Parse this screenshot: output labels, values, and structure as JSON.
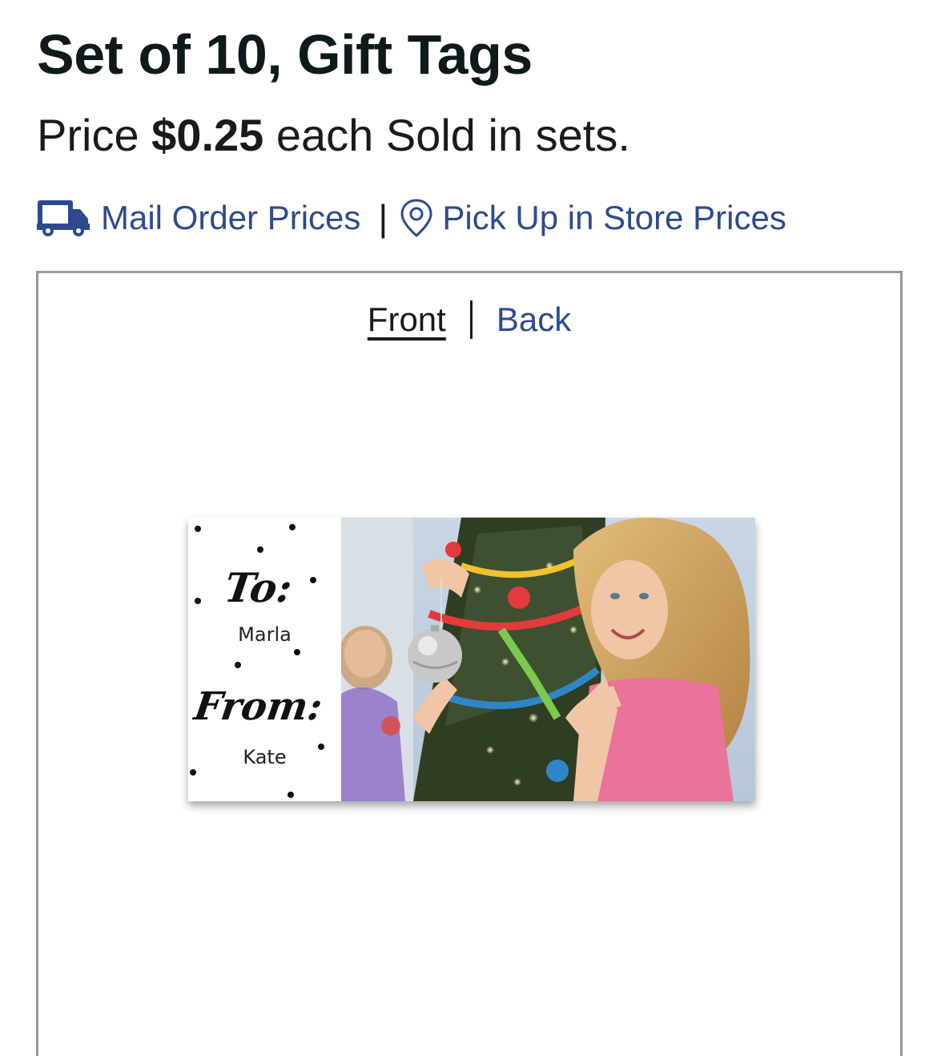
{
  "product": {
    "title": "Set of 10, Gift Tags",
    "price_prefix": "Price",
    "price_amount": "$0.25",
    "price_suffix": "each Sold in sets."
  },
  "links": {
    "mail_order": "Mail Order Prices",
    "separator": "|",
    "pickup": "Pick Up in Store Prices",
    "mail_icon": "truck-icon",
    "pickup_icon": "location-pin-icon",
    "link_color": "#2e4a8f"
  },
  "preview": {
    "front_label": "Front",
    "back_label": "Back",
    "active_side": "Front"
  },
  "tag": {
    "to_label": "To:",
    "to_name": "Marla",
    "from_label": "From:",
    "from_name": "Kate"
  }
}
